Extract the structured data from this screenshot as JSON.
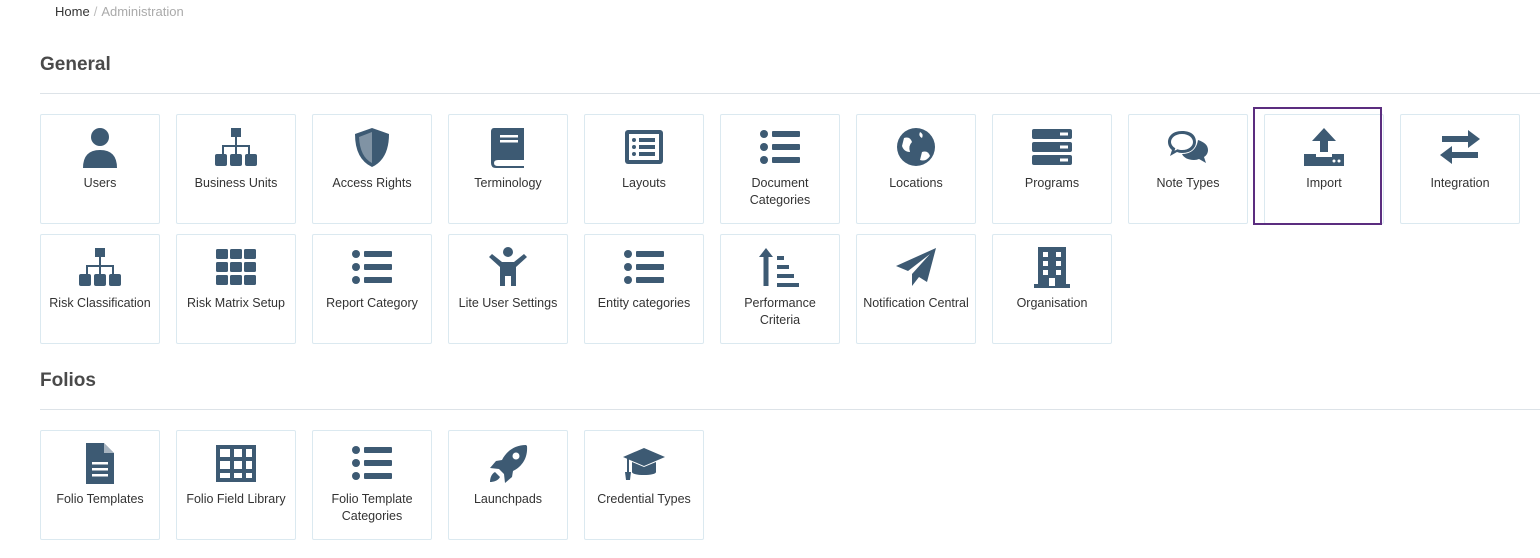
{
  "breadcrumb": {
    "home": "Home",
    "separator": "/",
    "current": "Administration"
  },
  "sections": {
    "general": {
      "title": "General",
      "tiles": [
        {
          "label": "Users",
          "icon": "user-icon"
        },
        {
          "label": "Business Units",
          "icon": "sitemap-icon"
        },
        {
          "label": "Access Rights",
          "icon": "shield-icon"
        },
        {
          "label": "Terminology",
          "icon": "book-icon"
        },
        {
          "label": "Layouts",
          "icon": "list-alt-icon"
        },
        {
          "label": "Document Categories",
          "icon": "list-icon"
        },
        {
          "label": "Locations",
          "icon": "globe-icon"
        },
        {
          "label": "Programs",
          "icon": "server-icon"
        },
        {
          "label": "Note Types",
          "icon": "comments-icon"
        },
        {
          "label": "Import",
          "icon": "upload-icon",
          "selected": true
        },
        {
          "label": "Integration",
          "icon": "exchange-icon"
        },
        {
          "label": "Risk Classification",
          "icon": "sitemap-icon"
        },
        {
          "label": "Risk Matrix Setup",
          "icon": "th-icon"
        },
        {
          "label": "Report Category",
          "icon": "list-icon"
        },
        {
          "label": "Lite User Settings",
          "icon": "child-icon"
        },
        {
          "label": "Entity categories",
          "icon": "list-icon"
        },
        {
          "label": "Performance Criteria",
          "icon": "sort-amount-up-icon"
        },
        {
          "label": "Notification Central",
          "icon": "paper-plane-icon"
        },
        {
          "label": "Organisation",
          "icon": "building-icon"
        }
      ]
    },
    "folios": {
      "title": "Folios",
      "tiles": [
        {
          "label": "Folio Templates",
          "icon": "file-alt-icon"
        },
        {
          "label": "Folio Field Library",
          "icon": "table-icon"
        },
        {
          "label": "Folio Template Categories",
          "icon": "list-icon"
        },
        {
          "label": "Launchpads",
          "icon": "rocket-icon"
        },
        {
          "label": "Credential Types",
          "icon": "graduation-cap-icon"
        }
      ]
    }
  },
  "colors": {
    "icon": "#3d5a73",
    "tile_border": "#dbe9f0",
    "selected_border": "#5b2d7f"
  }
}
